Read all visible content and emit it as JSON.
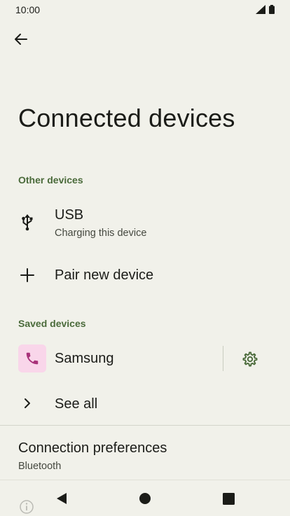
{
  "status_bar": {
    "time": "10:00"
  },
  "page": {
    "title": "Connected devices"
  },
  "sections": {
    "other_devices": {
      "header": "Other devices",
      "usb": {
        "title": "USB",
        "summary": "Charging this device",
        "icon": "usb-icon"
      },
      "pair": {
        "title": "Pair new device",
        "icon": "plus-icon"
      }
    },
    "saved_devices": {
      "header": "Saved devices",
      "device": {
        "title": "Samsung",
        "icon": "phone-icon",
        "settings_icon": "gear-icon"
      },
      "see_all": {
        "title": "See all",
        "icon": "chevron-right-icon"
      }
    },
    "connection_preferences": {
      "title": "Connection preferences",
      "summary": "Bluetooth"
    }
  },
  "colors": {
    "background": "#f1f1ea",
    "accent": "#4a6a3a",
    "device_icon_bg": "#f9d6ea",
    "device_icon_fg": "#a8327a",
    "text_primary": "#1b1c18",
    "text_secondary": "#45483f"
  }
}
